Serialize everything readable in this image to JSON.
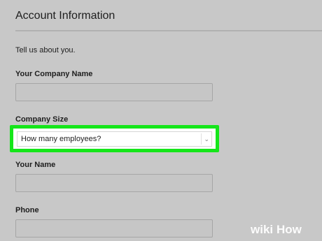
{
  "section": {
    "title": "Account Information",
    "intro": "Tell us about you."
  },
  "fields": {
    "company_name": {
      "label": "Your Company Name",
      "value": ""
    },
    "company_size": {
      "label": "Company Size",
      "value": "How many employees?"
    },
    "your_name": {
      "label": "Your Name",
      "value": ""
    },
    "phone": {
      "label": "Phone",
      "value": ""
    }
  },
  "watermark": {
    "text": "wikiHow"
  },
  "colors": {
    "highlight": "#15e61a",
    "background": "#c8c8c8",
    "input_fill": "#c6c6c6"
  }
}
